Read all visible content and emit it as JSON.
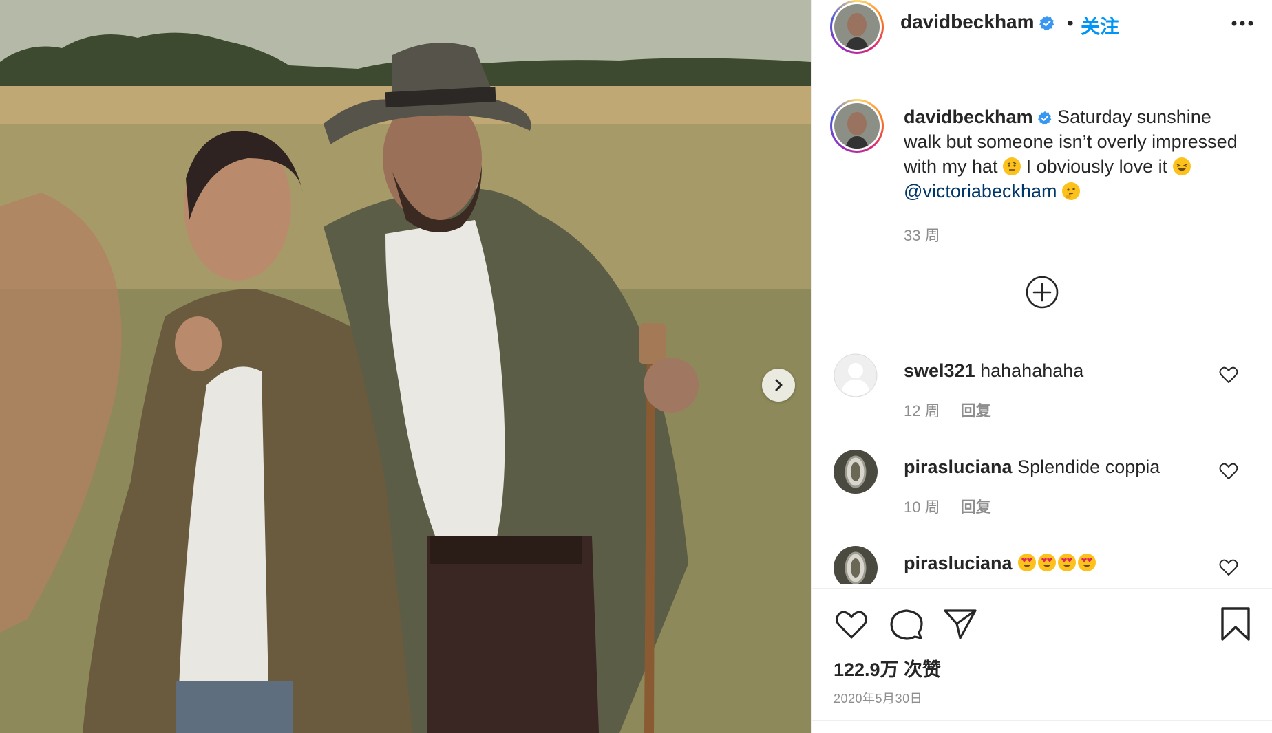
{
  "post": {
    "username": "davidbeckham",
    "follow_label": "关注",
    "header_separator": "•"
  },
  "caption": {
    "username": "davidbeckham",
    "text_part1": "Saturday sunshine walk but someone isn’t overly impressed with my hat",
    "text_part2": "I obviously love it",
    "mention": "@victoriabeckham",
    "time": "33 周"
  },
  "comments": [
    {
      "username": "swel321",
      "text": "hahahahaha",
      "time": "12 周",
      "reply": "回复"
    },
    {
      "username": "pirasluciana",
      "text": "Splendide coppia",
      "time": "10 周",
      "reply": "回复"
    },
    {
      "username": "pirasluciana",
      "text": "",
      "time": "",
      "reply": ""
    }
  ],
  "footer": {
    "likes": "122.9万 次赞",
    "date": "2020年5月30日"
  },
  "icons": {
    "verified": "verified-badge-icon",
    "more": "more-options-icon",
    "next": "chevron-right-icon",
    "load_more": "plus-circle-icon",
    "like": "heart-icon",
    "comment": "comment-bubble-icon",
    "share": "paper-plane-icon",
    "save": "bookmark-icon"
  },
  "colors": {
    "accent": "#0095f6",
    "mention": "#00376b",
    "muted": "#8e8e8e",
    "text": "#262626"
  }
}
